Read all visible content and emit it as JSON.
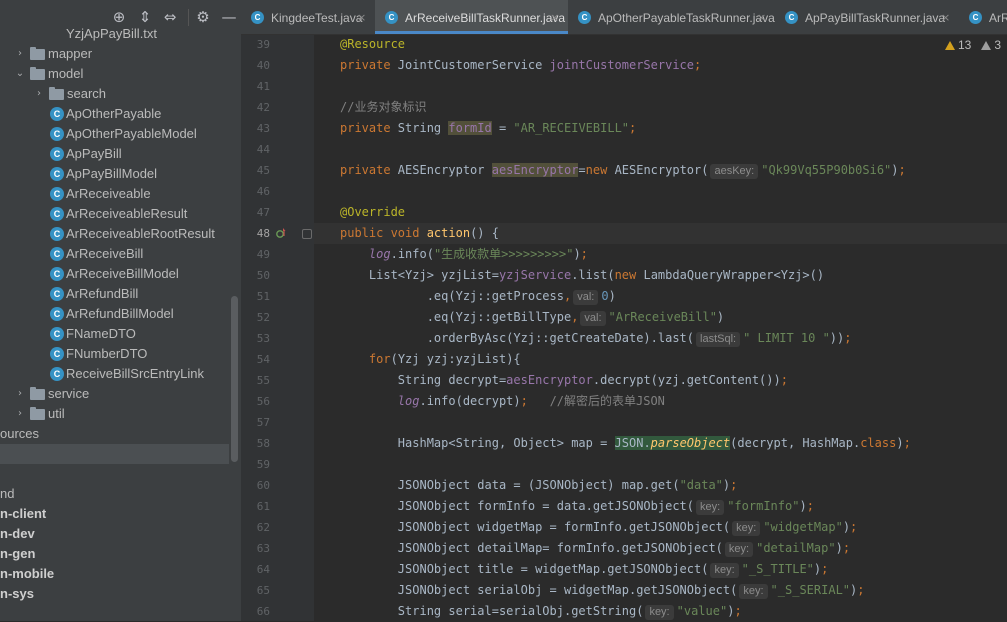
{
  "toolbar": {
    "icons": [
      "crosshair-icon",
      "expand-all-icon",
      "collapse-all-icon",
      "gear-icon",
      "hide-icon"
    ],
    "glyphs": [
      "⊕",
      "⇕",
      "⇔",
      "⚙",
      "—"
    ]
  },
  "tree": [
    {
      "label": "YzjApPayBill.txt",
      "type": "file",
      "indent": 50
    },
    {
      "label": "mapper",
      "type": "folder",
      "arrow": "›",
      "indent": 14
    },
    {
      "label": "model",
      "type": "folder",
      "arrow": "⌄",
      "indent": 14
    },
    {
      "label": "search",
      "type": "folder",
      "arrow": "›",
      "indent": 33
    },
    {
      "label": "ApOtherPayable",
      "type": "class",
      "indent": 50
    },
    {
      "label": "ApOtherPayableModel",
      "type": "class",
      "indent": 50
    },
    {
      "label": "ApPayBill",
      "type": "class",
      "indent": 50
    },
    {
      "label": "ApPayBillModel",
      "type": "class",
      "indent": 50
    },
    {
      "label": "ArReceiveable",
      "type": "class",
      "indent": 50
    },
    {
      "label": "ArReceiveableResult",
      "type": "class",
      "indent": 50
    },
    {
      "label": "ArReceiveableRootResult",
      "type": "class",
      "indent": 50
    },
    {
      "label": "ArReceiveBill",
      "type": "class",
      "indent": 50
    },
    {
      "label": "ArReceiveBillModel",
      "type": "class",
      "indent": 50
    },
    {
      "label": "ArRefundBill",
      "type": "class",
      "indent": 50
    },
    {
      "label": "ArRefundBillModel",
      "type": "class",
      "indent": 50
    },
    {
      "label": "FNameDTO",
      "type": "class",
      "indent": 50
    },
    {
      "label": "FNumberDTO",
      "type": "class",
      "indent": 50
    },
    {
      "label": "ReceiveBillSrcEntryLink",
      "type": "class",
      "indent": 50
    },
    {
      "label": "service",
      "type": "folder",
      "arrow": "›",
      "indent": 14
    },
    {
      "label": "util",
      "type": "folder",
      "arrow": "›",
      "indent": 14
    },
    {
      "label": "ources",
      "type": "plain",
      "indent": 0
    },
    {
      "label": "",
      "type": "selected",
      "indent": 0
    },
    {
      "label": "",
      "type": "plain",
      "indent": 0
    },
    {
      "label": "nd",
      "type": "plain",
      "indent": 0
    },
    {
      "label": "n-client",
      "type": "module",
      "indent": 0
    },
    {
      "label": "n-dev",
      "type": "module",
      "indent": 0
    },
    {
      "label": "n-gen",
      "type": "module",
      "indent": 0
    },
    {
      "label": "n-mobile",
      "type": "module",
      "indent": 0
    },
    {
      "label": "n-sys",
      "type": "module",
      "indent": 0
    }
  ],
  "tabs": [
    {
      "label": "KingdeeTest.java",
      "active": false
    },
    {
      "label": "ArReceiveBillTaskRunner.java",
      "active": true
    },
    {
      "label": "ApOtherPayableTaskRunner.java",
      "active": false
    },
    {
      "label": "ApPayBillTaskRunner.java",
      "active": false
    },
    {
      "label": "ArRec",
      "active": false
    }
  ],
  "tab_close": "×",
  "inspections": {
    "warnings": "13",
    "weak_warnings": "3"
  },
  "editor": {
    "current_line": 48,
    "lines": [
      {
        "n": 39,
        "tokens": [
          [
            "ann",
            "@Resource"
          ]
        ]
      },
      {
        "n": 40,
        "tokens": [
          [
            "kw",
            "private "
          ],
          [
            "",
            "JointCustomerService "
          ],
          [
            "fld",
            "jointCustomerService"
          ],
          [
            "kw",
            ";"
          ]
        ]
      },
      {
        "n": 41,
        "tokens": []
      },
      {
        "n": 42,
        "tokens": [
          [
            "cmt",
            "//业务对象标识"
          ]
        ]
      },
      {
        "n": 43,
        "tokens": [
          [
            "kw",
            "private "
          ],
          [
            "",
            "String "
          ],
          [
            "fld warn-hl",
            "formId"
          ],
          [
            "",
            " = "
          ],
          [
            "str",
            "\"AR_RECEIVEBILL\""
          ],
          [
            "kw",
            ";"
          ]
        ]
      },
      {
        "n": 44,
        "tokens": []
      },
      {
        "n": 45,
        "tokens": [
          [
            "kw",
            "private "
          ],
          [
            "",
            "AESEncryptor "
          ],
          [
            "fld warn-hl",
            "aesEncryptor"
          ],
          [
            "",
            "="
          ],
          [
            "kw",
            "new "
          ],
          [
            "",
            "AESEncryptor("
          ],
          [
            "hint",
            "aesKey:"
          ],
          [
            "str",
            "\"Qk99Vq55P90b0Si6\""
          ],
          [
            "",
            ")"
          ],
          [
            "kw",
            ";"
          ]
        ]
      },
      {
        "n": 46,
        "tokens": []
      },
      {
        "n": 47,
        "tokens": [
          [
            "ann",
            "@Override"
          ]
        ]
      },
      {
        "n": 48,
        "tokens": [
          [
            "kw",
            "public void "
          ],
          [
            "mth",
            "action"
          ],
          [
            "",
            "() {"
          ]
        ]
      },
      {
        "n": 49,
        "tokens": [
          [
            "",
            "    "
          ],
          [
            "fld it",
            "log"
          ],
          [
            "",
            ".info("
          ],
          [
            "str",
            "\"生成收款单>>>>>>>>>\""
          ],
          [
            "",
            ")"
          ],
          [
            "kw",
            ";"
          ]
        ]
      },
      {
        "n": 50,
        "tokens": [
          [
            "",
            "    List<Yzj> yzjList="
          ],
          [
            "fld",
            "yzjService"
          ],
          [
            "",
            ".list("
          ],
          [
            "kw",
            "new "
          ],
          [
            "",
            "LambdaQueryWrapper<Yzj>()"
          ]
        ]
      },
      {
        "n": 51,
        "tokens": [
          [
            "",
            "            .eq(Yzj::getProcess"
          ],
          [
            "kw",
            ","
          ],
          [
            "hint",
            "val:"
          ],
          [
            "num",
            "0"
          ],
          [
            "",
            ")"
          ]
        ]
      },
      {
        "n": 52,
        "tokens": [
          [
            "",
            "            .eq(Yzj::getBillType"
          ],
          [
            "kw",
            ","
          ],
          [
            "hint",
            "val:"
          ],
          [
            "str",
            "\"ArReceiveBill\""
          ],
          [
            "",
            ")"
          ]
        ]
      },
      {
        "n": 53,
        "tokens": [
          [
            "",
            "            .orderByAsc(Yzj::getCreateDate).last("
          ],
          [
            "hint",
            "lastSql:"
          ],
          [
            "str",
            "\" LIMIT 10 \""
          ],
          [
            "",
            "))"
          ],
          [
            "kw",
            ";"
          ]
        ]
      },
      {
        "n": 54,
        "tokens": [
          [
            "",
            "    "
          ],
          [
            "kw",
            "for"
          ],
          [
            "",
            "(Yzj yzj:yzjList){"
          ]
        ]
      },
      {
        "n": 55,
        "tokens": [
          [
            "",
            "        String decrypt="
          ],
          [
            "fld",
            "aesEncryptor"
          ],
          [
            "",
            ".decrypt(yzj.getContent())"
          ],
          [
            "kw",
            ";"
          ]
        ]
      },
      {
        "n": 56,
        "tokens": [
          [
            "",
            "        "
          ],
          [
            "fld it",
            "log"
          ],
          [
            "",
            ".info(decrypt)"
          ],
          [
            "kw",
            ";"
          ],
          [
            "",
            "   "
          ],
          [
            "cmt",
            "//解密后的表单JSON"
          ]
        ]
      },
      {
        "n": 57,
        "tokens": []
      },
      {
        "n": 58,
        "tokens": [
          [
            "",
            "        HashMap<String, Object> map = "
          ],
          [
            "json-hl",
            "JSON."
          ],
          [
            "mth it json-hl",
            "parseObject"
          ],
          [
            "",
            "(decrypt, HashMap."
          ],
          [
            "kw",
            "class"
          ],
          [
            "",
            ")"
          ],
          [
            "kw",
            ";"
          ]
        ]
      },
      {
        "n": 59,
        "tokens": []
      },
      {
        "n": 60,
        "tokens": [
          [
            "",
            "        JSONObject data = (JSONObject) map.get("
          ],
          [
            "str",
            "\"data\""
          ],
          [
            "",
            ")"
          ],
          [
            "kw",
            ";"
          ]
        ]
      },
      {
        "n": 61,
        "tokens": [
          [
            "",
            "        JSONObject formInfo = data.getJSONObject("
          ],
          [
            "hint",
            "key:"
          ],
          [
            "str",
            "\"formInfo\""
          ],
          [
            "",
            ")"
          ],
          [
            "kw",
            ";"
          ]
        ]
      },
      {
        "n": 62,
        "tokens": [
          [
            "",
            "        JSONObject widgetMap = formInfo.getJSONObject("
          ],
          [
            "hint",
            "key:"
          ],
          [
            "str",
            "\"widgetMap\""
          ],
          [
            "",
            ")"
          ],
          [
            "kw",
            ";"
          ]
        ]
      },
      {
        "n": 63,
        "tokens": [
          [
            "",
            "        JSONObject detailMap= formInfo.getJSONObject("
          ],
          [
            "hint",
            "key:"
          ],
          [
            "str",
            "\"detailMap\""
          ],
          [
            "",
            ")"
          ],
          [
            "kw",
            ";"
          ]
        ]
      },
      {
        "n": 64,
        "tokens": [
          [
            "",
            "        JSONObject title = widgetMap.getJSONObject("
          ],
          [
            "hint",
            "key:"
          ],
          [
            "str",
            "\"_S_TITLE\""
          ],
          [
            "",
            ")"
          ],
          [
            "kw",
            ";"
          ]
        ]
      },
      {
        "n": 65,
        "tokens": [
          [
            "",
            "        JSONObject serialObj = widgetMap.getJSONObject("
          ],
          [
            "hint",
            "key:"
          ],
          [
            "str",
            "\"_S_SERIAL\""
          ],
          [
            "",
            ")"
          ],
          [
            "kw",
            ";"
          ]
        ]
      },
      {
        "n": 66,
        "tokens": [
          [
            "",
            "        String serial=serialObj.getString("
          ],
          [
            "hint",
            "key:"
          ],
          [
            "str",
            "\"value\""
          ],
          [
            "",
            ")"
          ],
          [
            "kw",
            ";"
          ]
        ]
      }
    ]
  }
}
